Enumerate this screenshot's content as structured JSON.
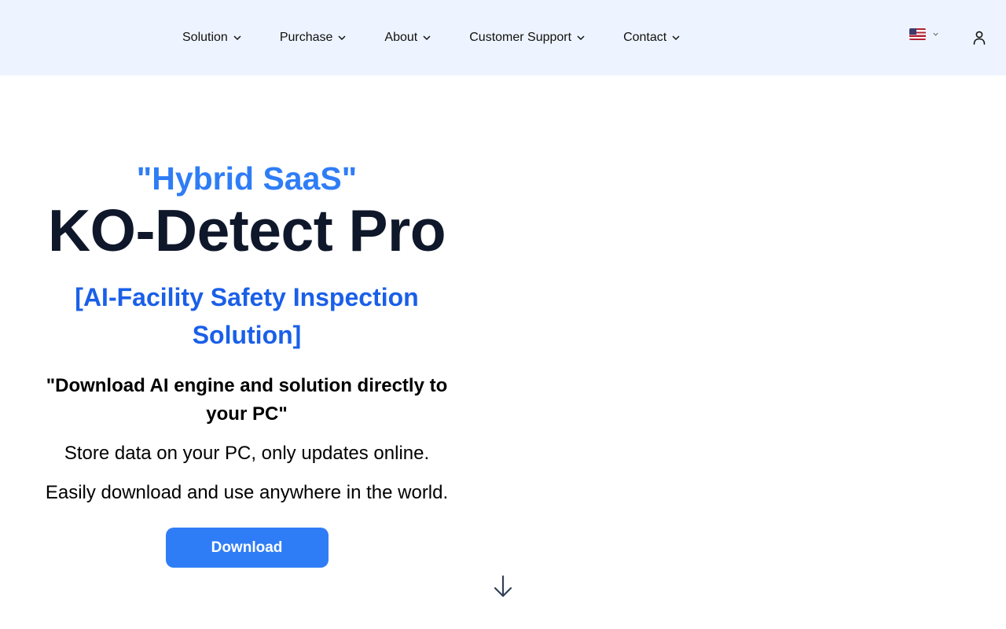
{
  "nav": {
    "items": [
      {
        "label": "Solution"
      },
      {
        "label": "Purchase"
      },
      {
        "label": "About"
      },
      {
        "label": "Customer Support"
      },
      {
        "label": "Contact"
      }
    ],
    "language_icon": "us-flag-icon",
    "user_icon": "user-icon"
  },
  "hero": {
    "eyebrow": "\"Hybrid SaaS\"",
    "title": "KO-Detect Pro",
    "subtitle_line1": "[AI-Facility Safety Inspection",
    "subtitle_line2": "Solution]",
    "lead_line1": "\"Download AI engine and solution directly to",
    "lead_line2": "your PC\"",
    "line1": "Store data on your PC, only updates online.",
    "line2": "Easily download and use anywhere in the world.",
    "download_label": "Download"
  },
  "colors": {
    "nav_bg": "#eef4ff",
    "accent": "#2f7df6",
    "subtitle": "#1a5fe8",
    "title": "#0f172a"
  }
}
